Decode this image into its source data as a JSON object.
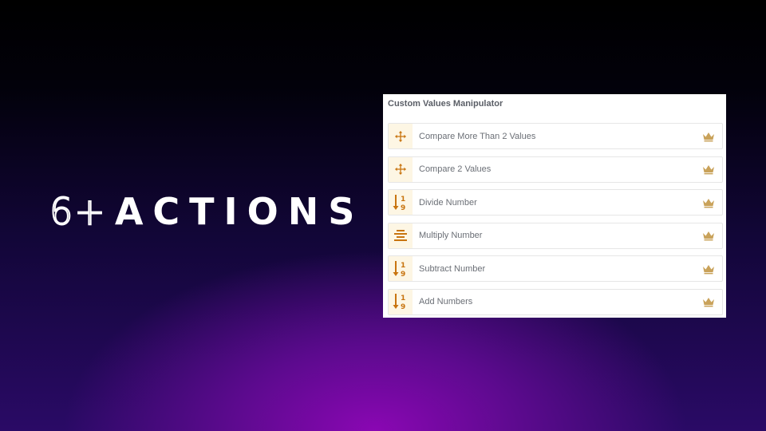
{
  "headline": {
    "number": "6+",
    "word": "ACTIONS"
  },
  "panel": {
    "title": "Custom Values Manipulator",
    "items": [
      {
        "label": "Compare More Than 2 Values",
        "icon": "move-arrows-icon"
      },
      {
        "label": "Compare 2 Values",
        "icon": "move-arrows-icon"
      },
      {
        "label": "Divide Number",
        "icon": "sort-numeric-icon"
      },
      {
        "label": "Multiply Number",
        "icon": "align-center-icon"
      },
      {
        "label": "Subtract Number",
        "icon": "sort-numeric-icon"
      },
      {
        "label": "Add Numbers",
        "icon": "sort-numeric-icon"
      }
    ],
    "badge_icon": "crown-icon"
  },
  "colors": {
    "icon_accent": "#c8740f",
    "crown": "#c9a25a",
    "icon_bg": "#fdf6e4"
  }
}
